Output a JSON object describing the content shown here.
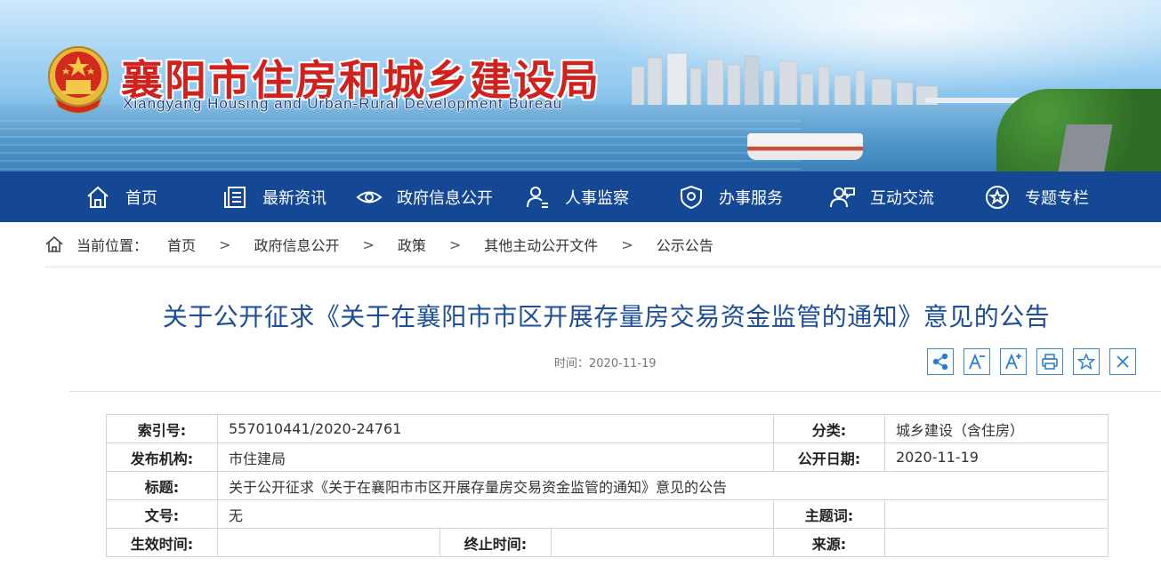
{
  "header": {
    "title": "襄阳市住房和城乡建设局",
    "subtitle": "Xiangyang Housing and Urban-Rural Development Bureau"
  },
  "nav": [
    {
      "label": "首页",
      "icon": "home-icon"
    },
    {
      "label": "最新资讯",
      "icon": "news-icon"
    },
    {
      "label": "政府信息公开",
      "icon": "eye-icon"
    },
    {
      "label": "人事监察",
      "icon": "person-icon"
    },
    {
      "label": "办事服务",
      "icon": "shield-icon"
    },
    {
      "label": "互动交流",
      "icon": "chat-people-icon"
    },
    {
      "label": "专题专栏",
      "icon": "star-circle-icon"
    }
  ],
  "breadcrumb": {
    "prefix": "当前位置：",
    "separator": ">",
    "items": [
      "首页",
      "政府信息公开",
      "政策",
      "其他主动公开文件",
      "公示公告"
    ]
  },
  "article": {
    "title": "关于公开征求《关于在襄阳市市区开展存量房交易资金监管的通知》意见的公告",
    "time": "时间：2020-11-19"
  },
  "tools": [
    "share-icon",
    "font-decrease-icon",
    "font-increase-icon",
    "print-icon",
    "favorite-icon",
    "close-icon"
  ],
  "meta": {
    "index_label": "索引号:",
    "index_value": "557010441/2020-24761",
    "category_label": "分类:",
    "category_value": "城乡建设（含住房）",
    "issuer_label": "发布机构:",
    "issuer_value": "市住建局",
    "pubdate_label": "公开日期:",
    "pubdate_value": "2020-11-19",
    "title_label": "标题:",
    "title_value": "关于公开征求《关于在襄阳市市区开展存量房交易资金监管的通知》意见的公告",
    "docno_label": "文号:",
    "docno_value": "无",
    "keyword_label": "主题词:",
    "keyword_value": "",
    "effective_label": "生效时间:",
    "effective_value": "",
    "expiry_label": "终止时间:",
    "expiry_value": "",
    "source_label": "来源:",
    "source_value": ""
  },
  "colors": {
    "nav_bg": "#144895",
    "title_blue": "#1d4e9a",
    "site_title_red": "#d0211c"
  }
}
